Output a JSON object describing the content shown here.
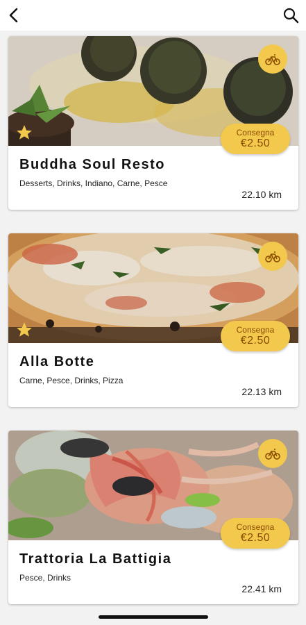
{
  "header": {
    "back_icon": "chevron-left-icon",
    "search_icon": "search-icon"
  },
  "colors": {
    "accent": "#f2c94c",
    "accent_text": "#8a4b00",
    "background": "#f2f2f2"
  },
  "restaurants": [
    {
      "name": "Buddha Soul Resto",
      "tags": "Desserts, Drinks, Indiano, Carne, Pesce",
      "distance": "22.10 km",
      "delivery_label": "Consegna",
      "delivery_price": "€2.50",
      "favorite": true,
      "delivery_icon": "bike-icon"
    },
    {
      "name": "Alla Botte",
      "tags": "Carne, Pesce, Drinks, Pizza",
      "distance": "22.13 km",
      "delivery_label": "Consegna",
      "delivery_price": "€2.50",
      "favorite": true,
      "delivery_icon": "bike-icon"
    },
    {
      "name": "Trattoria La Battigia",
      "tags": "Pesce, Drinks",
      "distance": "22.41 km",
      "delivery_label": "Consegna",
      "delivery_price": "€2.50",
      "favorite": false,
      "delivery_icon": "bike-icon"
    }
  ]
}
